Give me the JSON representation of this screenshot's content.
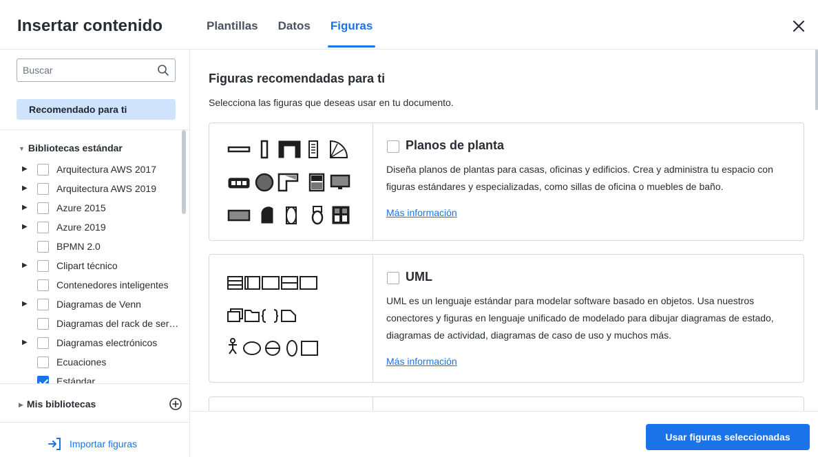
{
  "header": {
    "title": "Insertar contenido",
    "tabs": [
      {
        "label": "Plantillas",
        "active": false
      },
      {
        "label": "Datos",
        "active": false
      },
      {
        "label": "Figuras",
        "active": true
      }
    ],
    "close_icon": "close-icon"
  },
  "sidebar": {
    "search": {
      "placeholder": "Buscar",
      "value": "",
      "icon": "search-icon"
    },
    "recommended_label": "Recomendado para ti",
    "standard_libraries": {
      "title": "Bibliotecas estándar",
      "items": [
        {
          "label": "Arquitectura AWS 2017",
          "expandable": true,
          "checked": false
        },
        {
          "label": "Arquitectura AWS 2019",
          "expandable": true,
          "checked": false
        },
        {
          "label": "Azure 2015",
          "expandable": true,
          "checked": false
        },
        {
          "label": "Azure 2019",
          "expandable": true,
          "checked": false
        },
        {
          "label": "BPMN 2.0",
          "expandable": false,
          "checked": false
        },
        {
          "label": "Clipart técnico",
          "expandable": true,
          "checked": false
        },
        {
          "label": "Contenedores inteligentes",
          "expandable": false,
          "checked": false
        },
        {
          "label": "Diagramas de Venn",
          "expandable": true,
          "checked": false
        },
        {
          "label": "Diagramas del rack de ser…",
          "expandable": false,
          "checked": false
        },
        {
          "label": "Diagramas electrónicos",
          "expandable": true,
          "checked": false
        },
        {
          "label": "Ecuaciones",
          "expandable": false,
          "checked": false
        },
        {
          "label": "Estándar",
          "expandable": false,
          "checked": true
        }
      ]
    },
    "my_libraries": {
      "title": "Mis bibliotecas",
      "add_icon": "plus-circle-icon"
    },
    "import_label": "Importar figuras",
    "import_icon": "import-icon"
  },
  "main": {
    "title": "Figuras recomendadas para ti",
    "subtitle": "Selecciona las figuras que deseas usar en tu documento.",
    "cards": [
      {
        "title": "Planos de planta",
        "description": "Diseña planos de plantas para casas, oficinas y edificios. Crea y administra tu espacio con figuras estándares y especializadas, como sillas de oficina o muebles de baño.",
        "link": "Más información",
        "checked": false
      },
      {
        "title": "UML",
        "description": "UML es un lenguaje estándar para modelar software basado en objetos. Usa nuestros conectores y figuras en lenguaje unificado de modelado para dibujar diagramas de estado, diagramas de actividad, diagramas de caso de uso y muchos más.",
        "link": "Más información",
        "checked": false
      }
    ]
  },
  "footer": {
    "use_button": "Usar figuras seleccionadas"
  },
  "colors": {
    "accent": "#1a73e8",
    "recommended_bg": "#cfe3fc",
    "text": "#282c33",
    "border": "#d5d9df"
  }
}
